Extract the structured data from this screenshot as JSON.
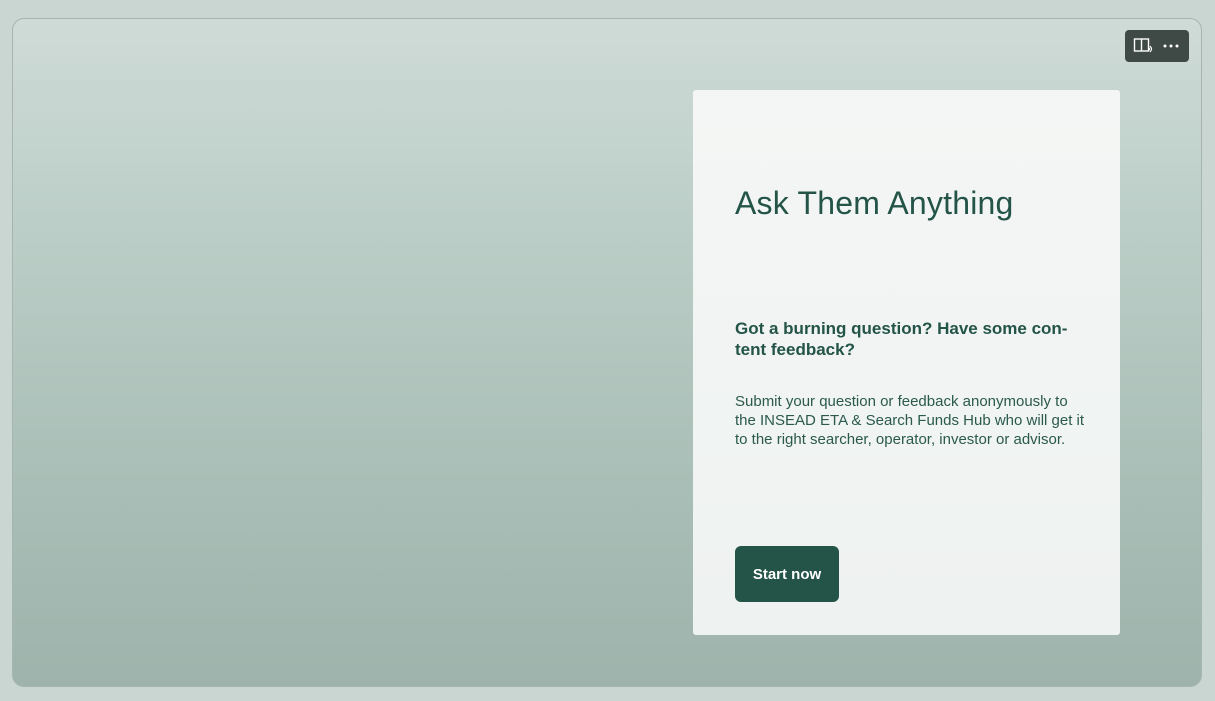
{
  "toolbar": {
    "immersive_icon": "immersive-reader-icon",
    "more_icon": "more-options-icon"
  },
  "card": {
    "title": "Ask Them Anything",
    "subtitle": "Got a burning question? Have some con-\ntent feedback?",
    "body": "Submit your question or feedback anonymously to the INSEAD ETA & Search Funds Hub who will get it to the right searcher, operator, investor or advisor.",
    "button_label": "Start now"
  },
  "colors": {
    "accent": "#235447",
    "card_background": "#f2f5f4",
    "toolbar_background": "#3f4a47"
  }
}
